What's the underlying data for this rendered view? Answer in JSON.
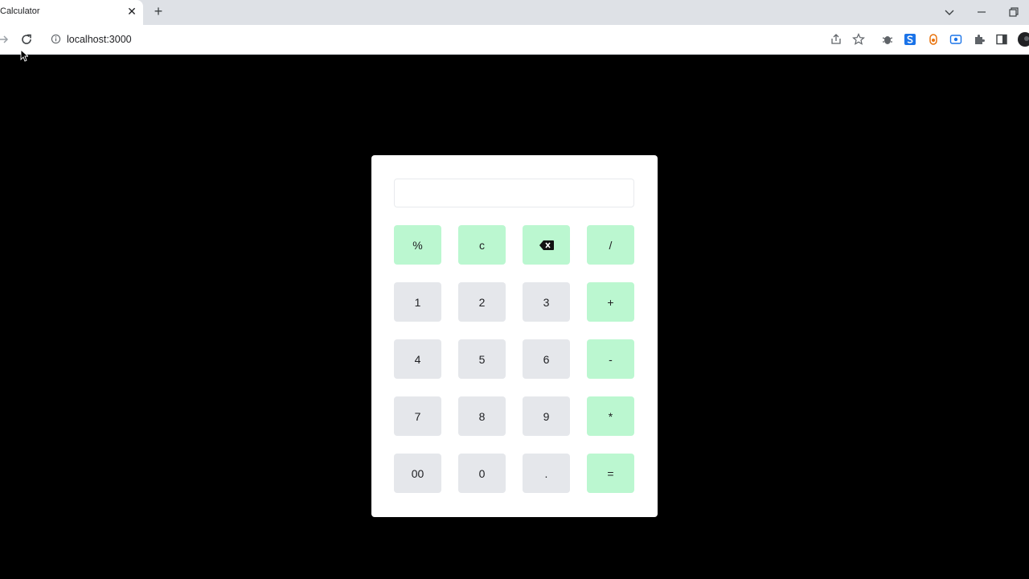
{
  "browser": {
    "tab": {
      "title": "Calculator"
    },
    "address": {
      "url": "localhost:3000"
    }
  },
  "calculator": {
    "display_value": "",
    "keys": [
      {
        "label": "%",
        "kind": "op"
      },
      {
        "label": "c",
        "kind": "op"
      },
      {
        "label": "",
        "kind": "op",
        "icon": "backspace-icon"
      },
      {
        "label": "/",
        "kind": "op"
      },
      {
        "label": "1",
        "kind": "num"
      },
      {
        "label": "2",
        "kind": "num"
      },
      {
        "label": "3",
        "kind": "num"
      },
      {
        "label": "+",
        "kind": "op"
      },
      {
        "label": "4",
        "kind": "num"
      },
      {
        "label": "5",
        "kind": "num"
      },
      {
        "label": "6",
        "kind": "num"
      },
      {
        "label": "-",
        "kind": "op"
      },
      {
        "label": "7",
        "kind": "num"
      },
      {
        "label": "8",
        "kind": "num"
      },
      {
        "label": "9",
        "kind": "num"
      },
      {
        "label": "*",
        "kind": "op"
      },
      {
        "label": "00",
        "kind": "num"
      },
      {
        "label": "0",
        "kind": "num"
      },
      {
        "label": ".",
        "kind": "num"
      },
      {
        "label": "=",
        "kind": "op"
      }
    ]
  },
  "colors": {
    "operator_key": "#bbf7d0",
    "number_key": "#e5e7eb",
    "page_background": "#000000",
    "card_background": "#ffffff"
  }
}
